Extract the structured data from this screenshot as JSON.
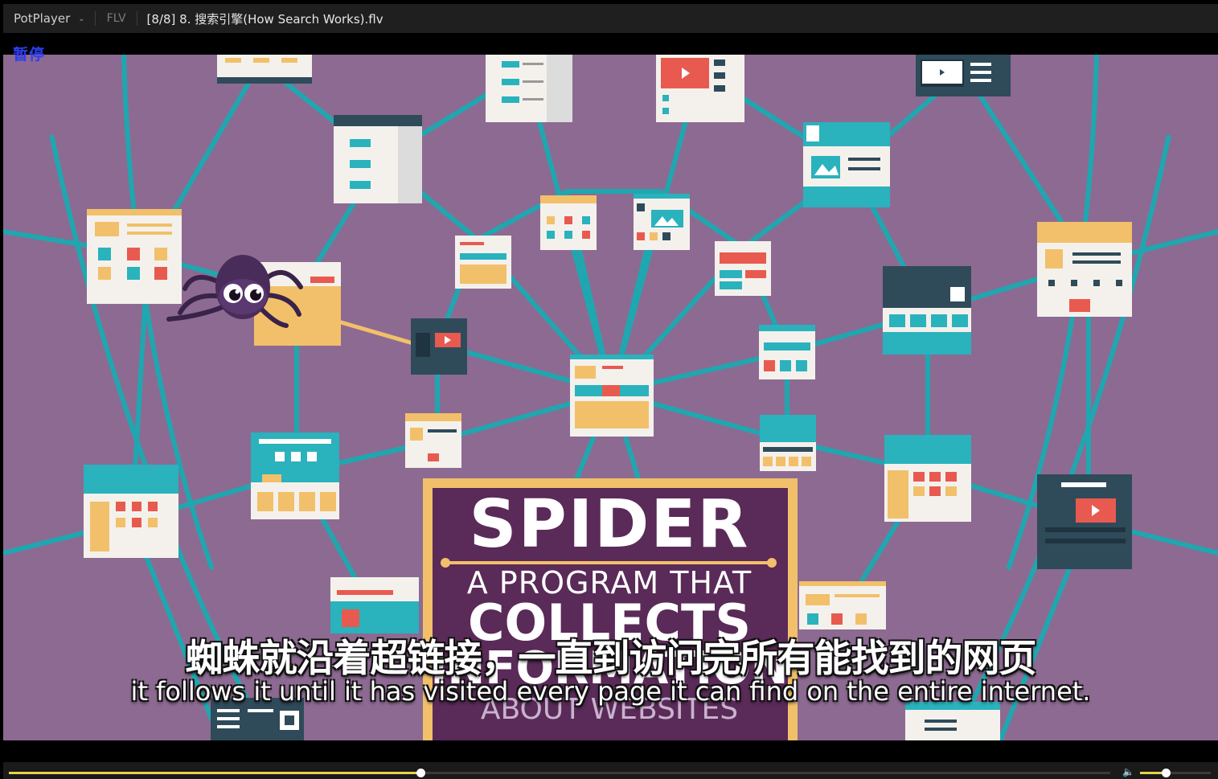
{
  "titlebar": {
    "app_name": "PotPlayer",
    "format": "FLV",
    "file_title": "[8/8] 8. 搜索引擎(How Search Works).flv"
  },
  "osd": {
    "status": "暂停"
  },
  "video_frame": {
    "title_card": {
      "headline": "SPIDER",
      "line1": "A PROGRAM THAT",
      "line2": "COLLECTS",
      "line3": "INFORMATION",
      "line4": "ABOUT WEBSITES"
    }
  },
  "subtitles": {
    "chinese": "蜘蛛就沿着超链接，一直到访问完所有能找到的网页",
    "english": "it follows it until it has visited every page it can find on the entire internet."
  },
  "playback": {
    "progress": 0.374,
    "volume": 0.36
  },
  "icons": [
    "chevron-down-icon",
    "volume-icon",
    "spider-mascot"
  ],
  "colors": {
    "background": "#8d6a92",
    "web_lines": "#1fa7b0",
    "accent_yellow": "#e8d24a",
    "card_purple": "#5a2a58",
    "card_border": "#f2c06a"
  }
}
